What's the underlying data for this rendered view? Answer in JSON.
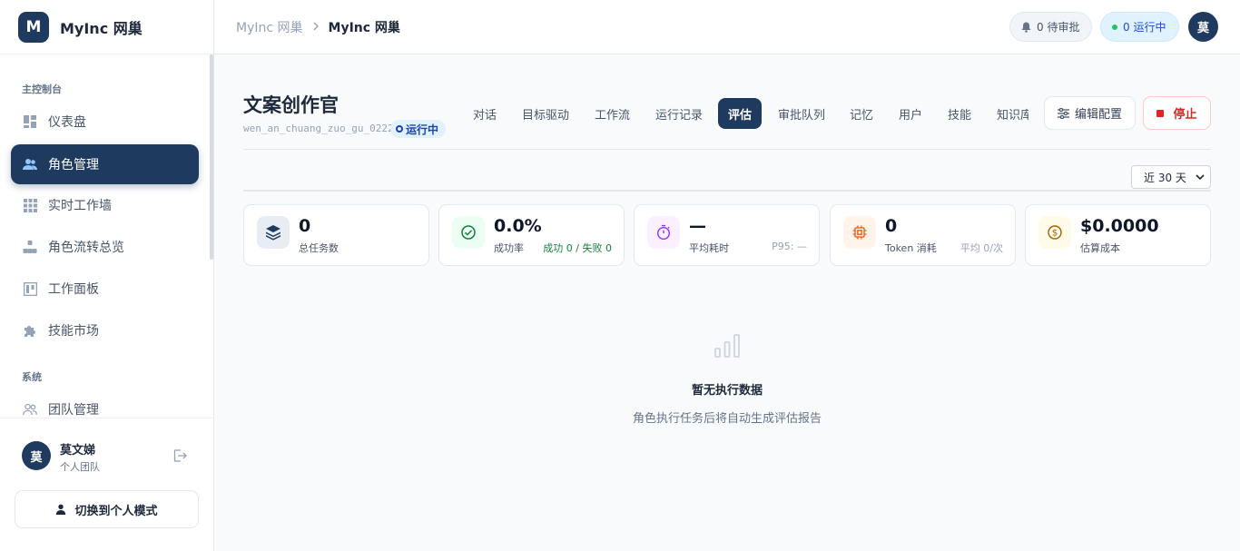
{
  "brand": {
    "logo_letter": "M",
    "name": "MyInc 网巢"
  },
  "sidebar": {
    "section_main": "主控制台",
    "section_system": "系统",
    "items": [
      {
        "label": "仪表盘",
        "icon": "dashboard-icon"
      },
      {
        "label": "角色管理",
        "icon": "users-icon",
        "active": true
      },
      {
        "label": "实时工作墙",
        "icon": "grid-icon"
      },
      {
        "label": "角色流转总览",
        "icon": "hierarchy-icon"
      },
      {
        "label": "工作面板",
        "icon": "kanban-icon"
      },
      {
        "label": "技能市场",
        "icon": "puzzle-icon"
      }
    ],
    "system_items": [
      {
        "label": "团队管理",
        "icon": "team-icon"
      }
    ],
    "user": {
      "avatar": "莫",
      "name": "莫文娣",
      "team": "个人团队"
    },
    "switch_label": "切换到个人模式"
  },
  "header": {
    "breadcrumb_parent": "MyInc 网巢",
    "breadcrumb_current": "MyInc 网巢",
    "pending_label": "0 待审批",
    "running_label": "0 运行中",
    "avatar": "莫"
  },
  "role": {
    "title": "文案创作官",
    "id": "wen_an_chuang_zuo_gu_0222",
    "status": "运行中"
  },
  "tabs": [
    "对话",
    "目标驱动",
    "工作流",
    "运行记录",
    "评估",
    "审批队列",
    "记忆",
    "用户",
    "技能",
    "知识库"
  ],
  "active_tab": "评估",
  "actions": {
    "edit_label": "编辑配置",
    "stop_label": "停止"
  },
  "range": {
    "selected": "近 30 天"
  },
  "stats": [
    {
      "value": "0",
      "label": "总任务数",
      "aux": "",
      "icon": "layers-icon"
    },
    {
      "value": "0.0%",
      "label": "成功率",
      "aux": "成功 0 / 失败 0",
      "icon": "check-circle-icon"
    },
    {
      "value": "—",
      "label": "平均耗时",
      "aux": "P95: —",
      "icon": "stopwatch-icon"
    },
    {
      "value": "0",
      "label": "Token 消耗",
      "aux": "平均 0/次",
      "icon": "chip-icon"
    },
    {
      "value": "$0.0000",
      "label": "估算成本",
      "aux": "",
      "icon": "dollar-coin-icon"
    }
  ],
  "colors": {
    "accent": "#1e3a5f",
    "danger": "#dc2626",
    "success": "#15803d"
  },
  "empty": {
    "title": "暂无执行数据",
    "subtitle": "角色执行任务后将自动生成评估报告",
    "icon": "bar-chart-icon"
  }
}
